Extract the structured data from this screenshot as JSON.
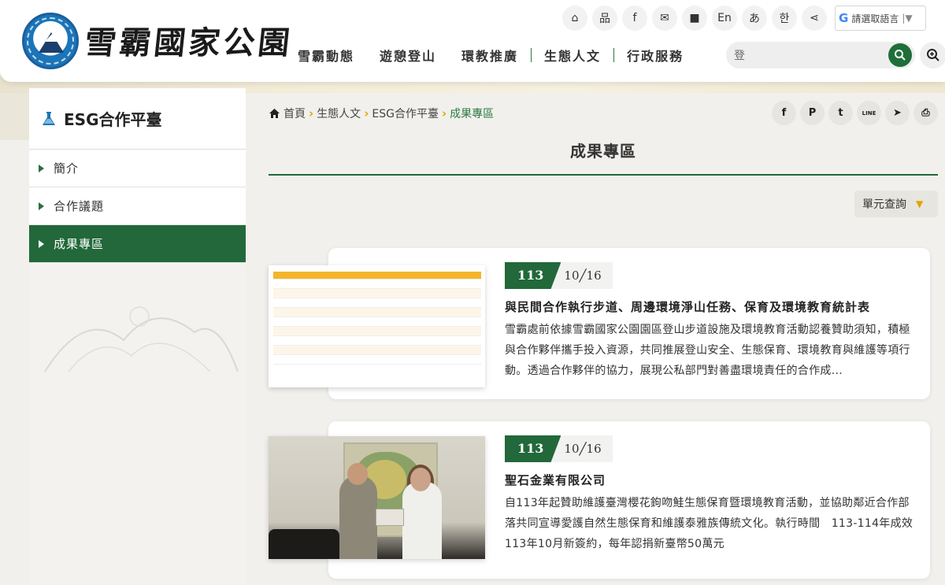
{
  "header": {
    "site_name": "雪霸國家公園",
    "toolbar": [
      {
        "name": "home-icon",
        "label": "⌂"
      },
      {
        "name": "sitemap-icon",
        "label": "品"
      },
      {
        "name": "facebook-icon",
        "label": "f"
      },
      {
        "name": "mail-icon",
        "label": "✉"
      },
      {
        "name": "folder-icon",
        "label": "■"
      },
      {
        "name": "lang-en-button",
        "label": "En"
      },
      {
        "name": "lang-jp-button",
        "label": "あ"
      },
      {
        "name": "lang-kr-button",
        "label": "한"
      },
      {
        "name": "share-icon",
        "label": "⋖"
      }
    ],
    "language_select": "請選取語言",
    "nav": [
      "雪霸動態",
      "遊憩登山",
      "環教推廣",
      "生態人文",
      "行政服務"
    ],
    "search_value": "登"
  },
  "sidebar": {
    "title": "ESG合作平臺",
    "items": [
      {
        "label": "簡介",
        "active": false
      },
      {
        "label": "合作議題",
        "active": false
      },
      {
        "label": "成果專區",
        "active": true
      }
    ]
  },
  "breadcrumb": [
    "首頁",
    "生態人文",
    "ESG合作平臺",
    "成果專區"
  ],
  "share_buttons": [
    {
      "name": "facebook-share-icon",
      "label": "f"
    },
    {
      "name": "plurk-share-icon",
      "label": "P"
    },
    {
      "name": "twitter-share-icon",
      "label": "t"
    },
    {
      "name": "line-share-icon",
      "label": "LINE"
    },
    {
      "name": "telegram-share-icon",
      "label": "➤"
    },
    {
      "name": "print-icon",
      "label": "⎙"
    }
  ],
  "page_title": "成果專區",
  "unit_query": "單元查詢",
  "cards": [
    {
      "year": "113",
      "month_day": "10╱16",
      "title": "與民間合作執行步道、周邊環境淨山任務、保育及環境教育統計表",
      "description": "雪霸處前依據雪霸國家公園園區登山步道設施及環境教育活動認養贊助須知，積極與合作夥伴攜手投入資源，共同推展登山安全、生態保育、環境教育與維護等項行動。透過合作夥伴的協力，展現公私部門對善盡環境責任的合作成..."
    },
    {
      "year": "113",
      "month_day": "10╱16",
      "title": "聖石金業有限公司",
      "description": "自113年起贊助維護臺灣櫻花鉤吻鮭生態保育暨環境教育活動，並協助鄰近合作部落共同宣導愛護自然生態保育和維護泰雅族傳統文化。執行時間　113-114年成效　　113年10月新簽約，每年認捐新臺幣50萬元"
    }
  ]
}
